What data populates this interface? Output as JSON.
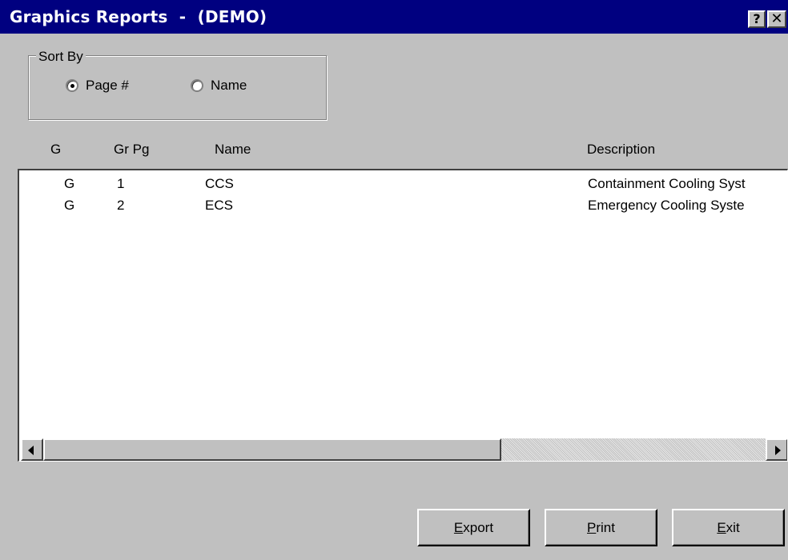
{
  "window": {
    "title": "Graphics Reports  -  (DEMO)",
    "help_glyph": "?",
    "close_glyph": "✕"
  },
  "sort_group": {
    "label": "Sort By",
    "options": [
      {
        "label": "Page #",
        "checked": true
      },
      {
        "label": "Name",
        "checked": false
      }
    ]
  },
  "table": {
    "columns": [
      "G",
      "Gr Pg",
      "Name",
      "Description"
    ],
    "rows": [
      {
        "g": "G",
        "gr_pg": "1",
        "name": "CCS",
        "description": "Containment Cooling Syst"
      },
      {
        "g": "G",
        "gr_pg": "2",
        "name": "ECS",
        "description": "Emergency Cooling Syste"
      }
    ]
  },
  "buttons": {
    "export": {
      "mnemonic": "E",
      "rest": "xport"
    },
    "print": {
      "mnemonic": "P",
      "rest": "rint"
    },
    "exit": {
      "mnemonic": "E",
      "rest": "xit"
    }
  },
  "colors": {
    "titlebar": "#000080",
    "face": "#c0c0c0"
  }
}
